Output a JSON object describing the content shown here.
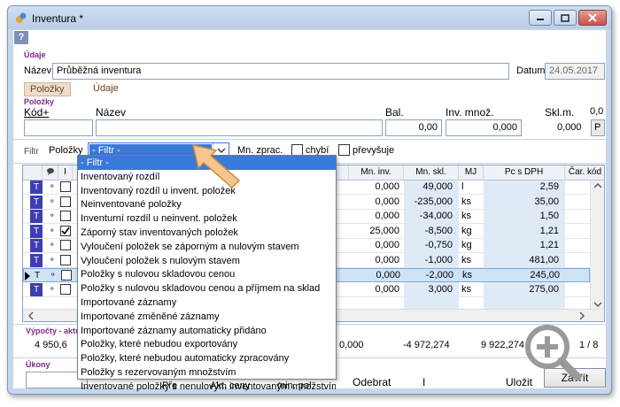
{
  "window": {
    "title": "Inventura *"
  },
  "help": "?",
  "udaje_section": "Údaje",
  "nazev": {
    "label": "Název",
    "value": "Průběžná inventura"
  },
  "datum": {
    "label": "Datum",
    "value": "24.05.2017"
  },
  "tabs": [
    {
      "label": "Položky"
    },
    {
      "label": "Údaje"
    }
  ],
  "polozky_section": "Položky",
  "headers": {
    "kod": "Kód+",
    "nazev": "Název",
    "bal": "Bal.",
    "inv_mnoz": "Inv. množ.",
    "sklm": "Skl.m."
  },
  "entry": {
    "bal_value": "0,00",
    "inv_value": "0,000",
    "sklm_value": "0,0",
    "sklm_value2": "0,000",
    "p_button": "P"
  },
  "filter": {
    "label": "Filtr",
    "source": "Položky",
    "selected": "- Filtr -",
    "mn_zprac": "Mn. zprac.",
    "chybi": "chybí",
    "prevysuje": "převyšuje"
  },
  "grid": {
    "columns": {
      "mn_inv": "Mn. inv.",
      "mn_skl": "Mn. skl.",
      "mj": "MJ",
      "pc_dph": "Pc s DPH",
      "car_kod": "Čar. kód",
      "flag": "I"
    },
    "rows": [
      {
        "type": "T",
        "flag_i": "",
        "mn_inv": "0,000",
        "mn_skl": "49,000",
        "mj": "l",
        "pc": "2,59"
      },
      {
        "type": "T",
        "flag_i": "",
        "mn_inv": "0,000",
        "mn_skl": "-235,000",
        "mj": "ks",
        "pc": "35,00"
      },
      {
        "type": "T",
        "flag_i": "",
        "mn_inv": "0,000",
        "mn_skl": "-34,000",
        "mj": "ks",
        "pc": "1,50"
      },
      {
        "type": "T",
        "flag_i": "",
        "mn_inv": "25,000",
        "mn_skl": "-8,500",
        "mj": "kg",
        "pc": "1,21"
      },
      {
        "type": "T",
        "flag_i": "",
        "mn_inv": "0,000",
        "mn_skl": "-0,750",
        "mj": "kg",
        "pc": "1,21"
      },
      {
        "type": "T",
        "flag_i": "",
        "mn_inv": "0,000",
        "mn_skl": "-1,000",
        "mj": "ks",
        "pc": "481,00"
      },
      {
        "type": "T",
        "flag_i": "",
        "mn_inv": "0,000",
        "mn_skl": "-2,000",
        "mj": "ks",
        "pc": "245,00"
      },
      {
        "type": "T",
        "flag_i": "",
        "mn_inv": "0,000",
        "mn_skl": "3,000",
        "mj": "ks",
        "pc": "275,00"
      }
    ]
  },
  "dropdown_items": [
    "- Filtr -",
    "Inventovaný rozdíl",
    "Inventovaný rozdíl u invent. položek",
    "Neinventované položky",
    "Inventurní rozdíl u neinvent. položek",
    "Záporný stav inventovaných položek",
    "Vyloučení položek se záporným a nulovým stavem",
    "Vyloučení položek s nulovým stavem",
    "Položky s nulovou skladovou cenou",
    "Položky s nulovou skladovou cenou a příjmem na sklad",
    "Importované záznamy",
    "Importované změněné záznamy",
    "Importované záznamy automaticky přidáno",
    "Položky, které nebudou exportovány",
    "Položky, které nebudou automaticky zpracovány",
    "Položky s rezervovaným množstvím",
    "Inventované položky s nenulovým inventovaným množstvím"
  ],
  "summary": {
    "label": "Výpočty - aktuá",
    "v1": "4 950,6",
    "v2": "0,000",
    "v3": "-4 972,274",
    "v4": "9 922,274",
    "v5": "1 / 8"
  },
  "bottom": {
    "ukony": "Úkony",
    "odebrat": "Odebrat",
    "i_label": "I",
    "ulozit": "Uložit",
    "zavrit": "Zavřít",
    "partial1": "Pře",
    "partial2": "Akt. ceny",
    "partial3": "min. pol."
  },
  "colors": {
    "accent": "#3979d7",
    "section": "#7c2a86",
    "tbadge": "#3d3fb0"
  }
}
